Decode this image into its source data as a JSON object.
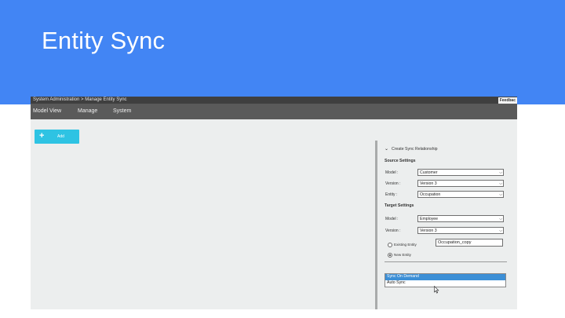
{
  "slide": {
    "title": "Entity Sync",
    "background": "#4285f4"
  },
  "app": {
    "breadcrumb": "System Administration > Manage Entity Sync",
    "feedback": "Feedbac",
    "menu": [
      "Model View",
      "Manage",
      "System"
    ],
    "add_button": "Add",
    "accent": "#2ec3e3"
  },
  "panel": {
    "title": "Create Sync Relationship",
    "source": {
      "heading": "Source Settings",
      "model_label": "Model :",
      "model_value": "Customer",
      "version_label": "Version :",
      "version_value": "Version 3",
      "entity_label": "Entity :",
      "entity_value": "Occupation"
    },
    "target": {
      "heading": "Target Settings",
      "model_label": "Model :",
      "model_value": "Employee",
      "version_label": "Version :",
      "version_value": "Version 3",
      "existing_entity_label": "Existing Entity",
      "new_entity_label": "New Entity",
      "new_entity_name": "Occupation_copy",
      "selected_option": "New Entity"
    },
    "sync_options": [
      "Sync On Demand",
      "Auto Sync"
    ],
    "sync_selected": "Sync On Demand",
    "selection_color": "#3c8fd6"
  }
}
